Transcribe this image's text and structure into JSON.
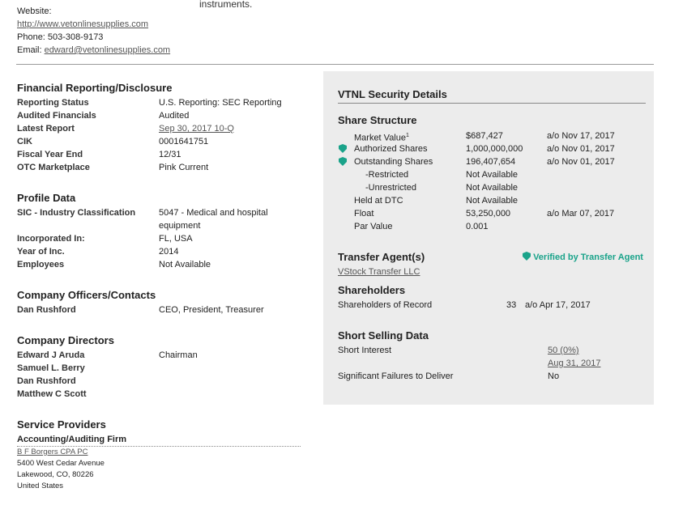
{
  "header": {
    "website_label": "Website:",
    "website_url": "http://www.vetonlinesupplies.com",
    "phone": "Phone: 503-308-9173",
    "email_label": "Email:",
    "email": "edward@vetonlinesupplies.com",
    "instruments_tail": "instruments."
  },
  "financial": {
    "title": "Financial Reporting/Disclosure",
    "rows": [
      {
        "label": "Reporting Status",
        "value": "U.S. Reporting: SEC Reporting"
      },
      {
        "label": "Audited Financials",
        "value": "Audited"
      },
      {
        "label": "Latest Report",
        "value": "Sep 30, 2017 10-Q"
      },
      {
        "label": "CIK",
        "value": "0001641751"
      },
      {
        "label": "Fiscal Year End",
        "value": "12/31"
      },
      {
        "label": "OTC Marketplace",
        "value": "Pink Current"
      }
    ]
  },
  "profile": {
    "title": "Profile Data",
    "sic_label": "SIC - Industry Classification",
    "sic_value_1": "5047 - Medical and hospital",
    "sic_value_2": "equipment",
    "rows": [
      {
        "label": "Incorporated In:",
        "value": "FL, USA"
      },
      {
        "label": "Year of Inc.",
        "value": "2014"
      },
      {
        "label": "Employees",
        "value": "Not Available"
      }
    ]
  },
  "officers": {
    "title": "Company Officers/Contacts",
    "name": "Dan Rushford",
    "role": "CEO, President, Treasurer"
  },
  "directors": {
    "title": "Company Directors",
    "people": [
      {
        "name": "Edward J Aruda",
        "role": "Chairman"
      },
      {
        "name": "Samuel L. Berry",
        "role": ""
      },
      {
        "name": "Dan Rushford",
        "role": ""
      },
      {
        "name": "Matthew C Scott",
        "role": ""
      }
    ]
  },
  "services": {
    "title": "Service Providers",
    "auditing_head": "Accounting/Auditing Firm",
    "firm": "B F Borgers CPA PC",
    "addr1": "5400 West Cedar Avenue",
    "addr2": "Lakewood, CO, 80226",
    "addr3": "United States"
  },
  "security": {
    "title": "VTNL Security Details",
    "share_structure": {
      "title": "Share Structure",
      "market_value_label": "Market Value",
      "market_value_sup": "1",
      "market_value": "$687,427",
      "market_value_date": "a/o Nov 17, 2017",
      "authorized_label": "Authorized Shares",
      "authorized": "1,000,000,000",
      "authorized_date": "a/o Nov 01, 2017",
      "outstanding_label": "Outstanding Shares",
      "outstanding": "196,407,654",
      "outstanding_date": "a/o Nov 01, 2017",
      "restricted_label": "-Restricted",
      "restricted": "Not Available",
      "unrestricted_label": "-Unrestricted",
      "unrestricted": "Not Available",
      "dtc_label": "Held at DTC",
      "dtc": "Not Available",
      "float_label": "Float",
      "float": "53,250,000",
      "float_date": "a/o Mar 07, 2017",
      "par_label": "Par Value",
      "par": "0.001"
    },
    "transfer": {
      "title": "Transfer Agent(s)",
      "verified": "Verified by Transfer Agent",
      "agent": "VStock Transfer LLC"
    },
    "shareholders": {
      "title": "Shareholders",
      "label": "Shareholders of Record",
      "value": "33",
      "date": "a/o Apr 17, 2017"
    },
    "short": {
      "title": "Short Selling Data",
      "interest_label": "Short Interest",
      "interest_value": "50 (0%)",
      "interest_date": "Aug 31, 2017",
      "ftd_label": "Significant Failures to Deliver",
      "ftd_value": "No"
    }
  }
}
